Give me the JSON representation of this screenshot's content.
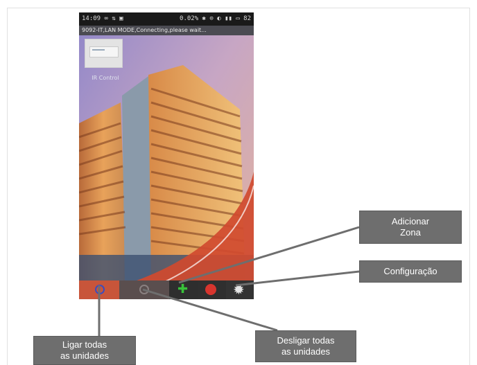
{
  "statusbar": {
    "left": "14:09 ∞ ⇅ ▣",
    "right": "0.02% ✱ ⊙ ◐ ▮▮ ▭ 82"
  },
  "connection_bar": "9092-IT,LAN MODE,Connecting,please wait...",
  "zone_thumbnail_label": "IR Control",
  "toolbar": {
    "power_on_icon": "power-ring-icon",
    "power_off_icon": "power-ring-icon",
    "add_icon": "plus-icon",
    "red_icon": "red-circle-icon",
    "settings_icon": "gear-icon",
    "accent_color": "#c8553a"
  },
  "callouts": {
    "adicionar_zona_line1": "Adicionar",
    "adicionar_zona_line2": "Zona",
    "configuracao": "Configuração",
    "desligar_line1": "Desligar todas",
    "desligar_line2": "as unidades",
    "ligar_line1": "Ligar todas",
    "ligar_line2": "as unidades"
  }
}
